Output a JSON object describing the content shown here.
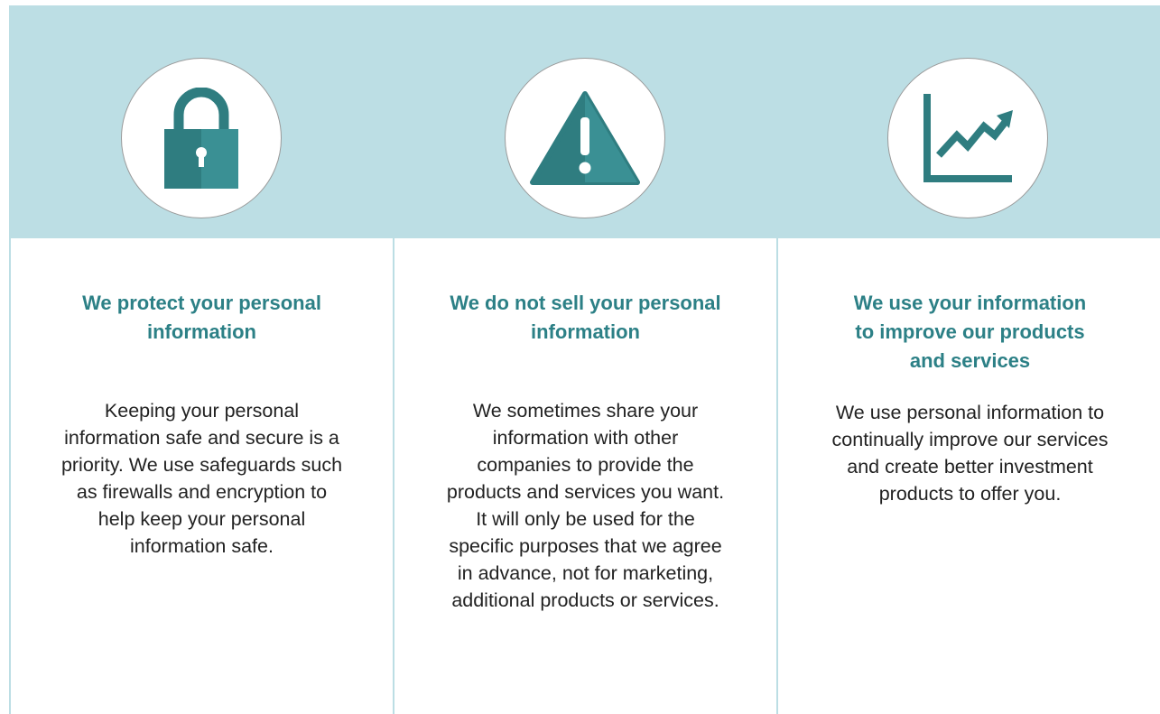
{
  "colors": {
    "band": "#bcdee4",
    "accent": "#2c8086",
    "icon": "#2f7d80",
    "text": "#222222"
  },
  "columns": [
    {
      "icon": "padlock-icon",
      "heading_lines": [
        "We protect your personal",
        "information"
      ],
      "body_lines": [
        "Keeping your personal",
        "information safe and secure is a",
        "priority. We use safeguards such",
        "as firewalls and encryption to",
        "help keep your personal",
        "information safe."
      ]
    },
    {
      "icon": "warning-icon",
      "heading_lines": [
        "We do not sell your personal",
        "information"
      ],
      "body_lines": [
        "We sometimes share your",
        "information with other",
        "companies to provide the",
        "products and services you want.",
        "It will only be used for the",
        "specific purposes that we agree",
        "in advance, not for marketing,",
        "additional products or services."
      ]
    },
    {
      "icon": "growth-chart-icon",
      "heading_lines": [
        "We use your information",
        "to improve our products",
        "and services"
      ],
      "body_lines": [
        "We use personal information to",
        "continually improve our services",
        "and create better investment",
        "products to offer you."
      ]
    }
  ]
}
